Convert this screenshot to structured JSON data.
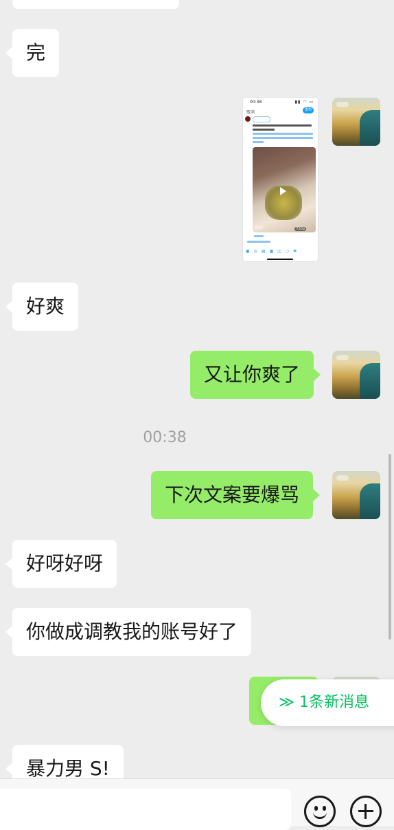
{
  "messages": {
    "m0": "",
    "m1": "完",
    "m2": "好爽",
    "m3": "又让你爽了",
    "m4": "下次文案要爆骂",
    "m5": "好呀好呀",
    "m6": "你做成调教我的账号好了",
    "m7": "",
    "m8": "暴力男 S!"
  },
  "timestamp": "00:38",
  "screenshot_msg": {
    "time": "00:38",
    "cancel": "取消",
    "send": "发布",
    "duration": "0:27",
    "quality": "720p"
  },
  "new_messages": {
    "label": "1条新消息",
    "chevron": "≫"
  },
  "colors": {
    "incoming_bubble": "#ffffff",
    "outgoing_bubble": "#95ec69",
    "accent": "#07c160",
    "background": "#ededed"
  },
  "icons": {
    "emoji": "smiley-icon",
    "more": "plus-circle-icon",
    "new_message": "chevron-double-down-icon"
  }
}
